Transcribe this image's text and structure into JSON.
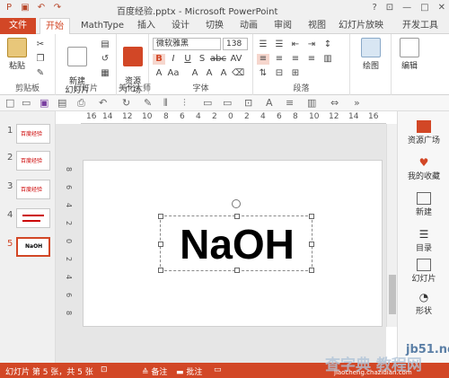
{
  "window": {
    "title": "百度经验.pptx - Microsoft PowerPoint",
    "controls": [
      "?",
      "⊡",
      "—",
      "□",
      "✕"
    ]
  },
  "tabs": [
    "文件",
    "开始",
    "MathType",
    "插入",
    "设计",
    "切换",
    "动画",
    "审阅",
    "视图",
    "幻灯片放映",
    "开发工具"
  ],
  "ribbon": {
    "groups": {
      "clipboard": "剪贴板",
      "slides": "幻灯片",
      "beautify": "美化大师",
      "font": "字体",
      "paragraph": "段落"
    },
    "paste_label": "粘贴",
    "new_slide_label": "新建\n幻灯片",
    "resource_label": "资源\n广场",
    "font_name": "微软雅黑",
    "font_size": "138",
    "drawing_label": "绘图",
    "edit_label": "编辑"
  },
  "ruler": {
    "labels": [
      "16",
      "14",
      "12",
      "10",
      "8",
      "6",
      "4",
      "2",
      "0",
      "2",
      "4",
      "6",
      "8",
      "10",
      "12",
      "14",
      "16"
    ]
  },
  "vruler": {
    "labels": [
      "8",
      "6",
      "4",
      "2",
      "0",
      "2",
      "4",
      "6",
      "8"
    ]
  },
  "thumbnails": [
    {
      "num": "1",
      "text": "百度经验"
    },
    {
      "num": "2",
      "text": "百度经验"
    },
    {
      "num": "3",
      "text": "百度经验"
    },
    {
      "num": "4",
      "text": ""
    },
    {
      "num": "5",
      "text": "NaOH"
    }
  ],
  "slide": {
    "text": "NaOH"
  },
  "right_pane": [
    {
      "label": "资源广场"
    },
    {
      "label": "我的收藏"
    },
    {
      "label": "新建"
    },
    {
      "label": "目录"
    },
    {
      "label": "幻灯片"
    },
    {
      "label": "形状"
    }
  ],
  "status": {
    "slide_info": "幻灯片 第 5 张，共 5 张",
    "notes": "备注",
    "comments": "批注"
  },
  "watermark": {
    "site": "jb51.net",
    "brand": "查字典 教程网",
    "url": "jiaocheng.chazidian.com"
  },
  "colors": {
    "accent": "#d24726",
    "ribbon_bg": "#ffffff",
    "status": "#d24726"
  }
}
